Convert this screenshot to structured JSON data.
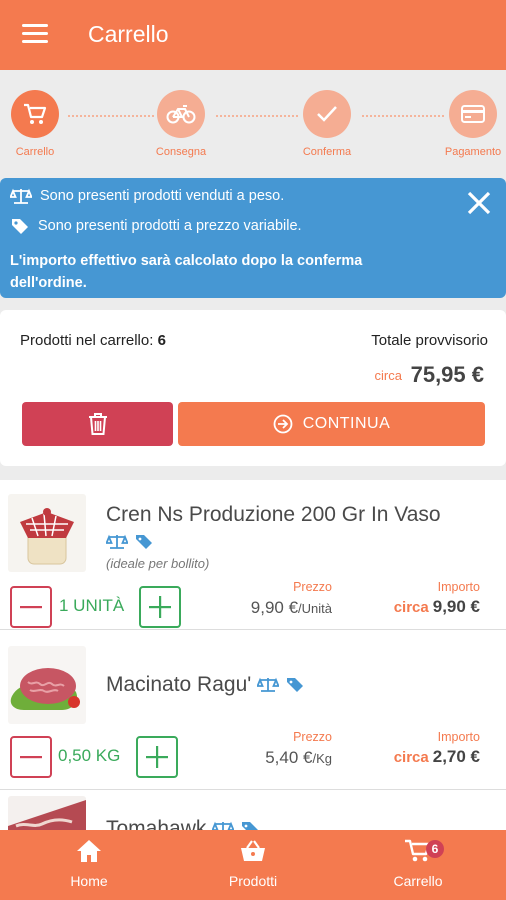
{
  "header": {
    "title": "Carrello"
  },
  "stepper": {
    "steps": [
      {
        "label": "Carrello",
        "icon": "cart-icon",
        "active": true
      },
      {
        "label": "Consegna",
        "icon": "bicycle-icon",
        "active": false
      },
      {
        "label": "Conferma",
        "icon": "check-icon",
        "active": false
      },
      {
        "label": "Pagamento",
        "icon": "credit-card-icon",
        "active": false
      }
    ]
  },
  "alert": {
    "line1": "Sono presenti prodotti venduti a peso.",
    "line2": "Sono presenti prodotti a prezzo variabile.",
    "bold": "L'importo effettivo sarà calcolato dopo la conferma dell'ordine."
  },
  "summary": {
    "count_label": "Prodotti nel carrello:",
    "count": "6",
    "total_label": "Totale provvisorio",
    "circa": "circa",
    "total": "75,95 €",
    "continue_label": "CONTINUA"
  },
  "items": [
    {
      "name": "Cren Ns Produzione 200 Gr In Vaso",
      "note": "(ideale per bollito)",
      "qty": "1 UNITÀ",
      "price_label": "Prezzo",
      "price": "9,90 €",
      "price_unit": "/Unità",
      "amount_label": "Importo",
      "amount_circa": "circa",
      "amount": "9,90 €"
    },
    {
      "name": "Macinato Ragu'",
      "qty": "0,50 KG",
      "price_label": "Prezzo",
      "price": "5,40 €",
      "price_unit": "/Kg",
      "amount_label": "Importo",
      "amount_circa": "circa",
      "amount": "2,70 €"
    },
    {
      "name": "Tomahawk"
    }
  ],
  "bottomnav": {
    "home": "Home",
    "products": "Prodotti",
    "cart": "Carrello",
    "cart_badge": "6"
  },
  "colors": {
    "primary": "#f47a4f",
    "info": "#4697d3",
    "danger": "#d04155",
    "success": "#3aaa5b"
  }
}
